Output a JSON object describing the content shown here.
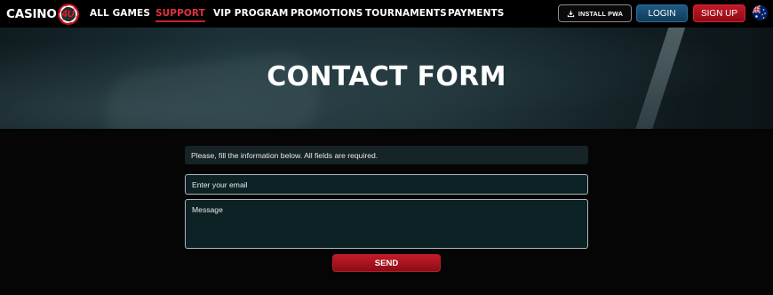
{
  "logo": {
    "text": "CASINO",
    "badge_text": "4U"
  },
  "nav": {
    "items": [
      {
        "label": "ALL GAMES",
        "active": false
      },
      {
        "label": "SUPPORT",
        "active": true
      },
      {
        "label": "VIP PROGRAM",
        "active": false
      },
      {
        "label": "PROMOTIONS",
        "active": false
      },
      {
        "label": "TOURNAMENTS",
        "active": false
      },
      {
        "label": "PAYMENTS",
        "active": false
      }
    ]
  },
  "header_actions": {
    "install_label": "INSTALL PWA",
    "login_label": "LOGIN",
    "signup_label": "SIGN UP",
    "language_flag": "australia-flag-icon"
  },
  "hero": {
    "title": "CONTACT FORM"
  },
  "form": {
    "notice": "Please, fill the information below. All fields are required.",
    "email_placeholder": "Enter your email",
    "message_placeholder": "Message",
    "send_label": "SEND"
  },
  "colors": {
    "accent_red": "#c81e2c",
    "login_blue": "#1f5a82",
    "background": "#050505"
  }
}
